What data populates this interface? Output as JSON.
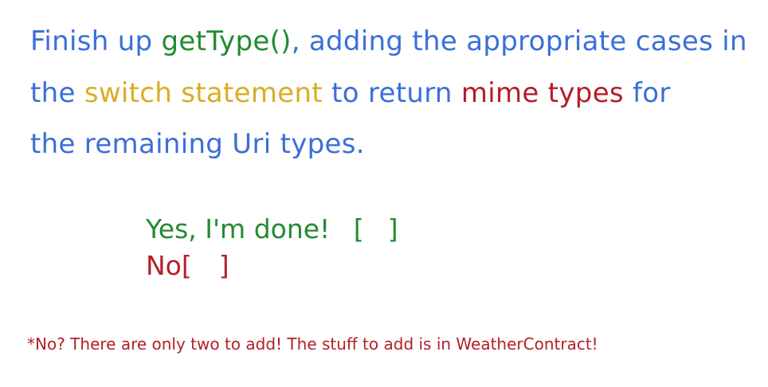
{
  "colors": {
    "blue": "#3a6fd8",
    "green": "#228b32",
    "yellow": "#d9ad23",
    "red": "#b51e28"
  },
  "prompt": {
    "line1": {
      "finish_up": "Finish up ",
      "method": "getType()",
      "rest": ", adding the appropriate cases in"
    },
    "line2": {
      "the": "the ",
      "switch_statement": "switch statement",
      "to_return": " to return ",
      "mime_types": "mime types",
      "for": " for"
    },
    "line3": {
      "text": "the remaining Uri types."
    }
  },
  "answers": {
    "yes_label": "Yes, I'm done!",
    "yes_box_open": "[",
    "yes_box_close": "]",
    "no_label": "No",
    "no_box_open": "[",
    "no_box_close": "]"
  },
  "footnote": "*No?  There are only two to add! The stuff to add is in WeatherContract!"
}
